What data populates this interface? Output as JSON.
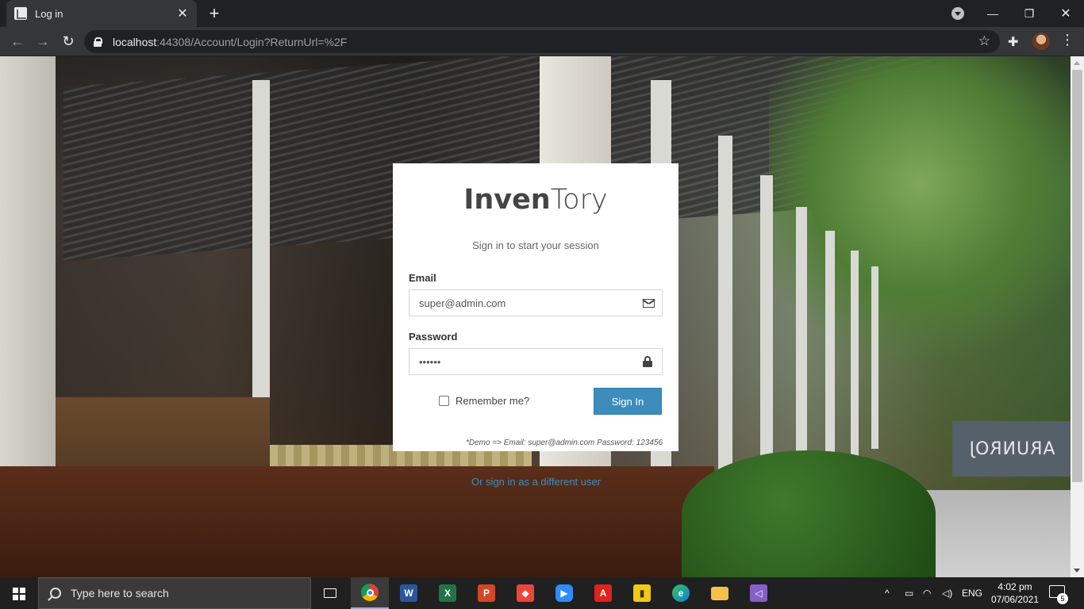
{
  "browser": {
    "tab_title": "Log in",
    "url_host": "localhost",
    "url_path": ":44308/Account/Login?ReturnUrl=%2F"
  },
  "login": {
    "logo_bold": "Inven",
    "logo_light": "Tory",
    "message": "Sign in to start your session",
    "email_label": "Email",
    "email_value": "super@admin.com",
    "password_label": "Password",
    "password_value": "••••••",
    "remember_label": "Remember me?",
    "signin_label": "Sign In",
    "demo_note": "*Demo => Email: super@admin.com Password: 123456"
  },
  "other_signin_link": "Or sign in as a different user",
  "background_sign": "ARUNROJ",
  "taskbar": {
    "search_placeholder": "Type here to search",
    "language": "ENG",
    "time": "4:02 pm",
    "date": "07/06/2021",
    "notification_count": "5",
    "apps": [
      {
        "name": "File Explorer view",
        "icon": "task-view-icon"
      },
      {
        "name": "Chrome",
        "icon": "chrome-icon",
        "color": "#e8453c"
      },
      {
        "name": "Word",
        "icon": "word-icon",
        "color": "#2b579a",
        "glyph": "W"
      },
      {
        "name": "Excel",
        "icon": "excel-icon",
        "color": "#217346",
        "glyph": "X"
      },
      {
        "name": "PowerPoint",
        "icon": "powerpoint-icon",
        "color": "#d24726",
        "glyph": "P"
      },
      {
        "name": "AnyDesk",
        "icon": "anydesk-icon",
        "color": "#ef443b",
        "glyph": "◆"
      },
      {
        "name": "Zoom",
        "icon": "zoom-icon",
        "color": "#2d8cff",
        "glyph": "▶"
      },
      {
        "name": "Acrobat",
        "icon": "acrobat-icon",
        "color": "#e2231a",
        "glyph": "A"
      },
      {
        "name": "Power BI",
        "icon": "powerbi-icon",
        "color": "#f2c811",
        "glyph": "▮"
      },
      {
        "name": "Edge",
        "icon": "edge-icon",
        "color": "#0f7fd6",
        "glyph": "e"
      },
      {
        "name": "Folder",
        "icon": "folder-icon",
        "color": "#f5c04a",
        "glyph": "▬"
      },
      {
        "name": "Visual Studio",
        "icon": "visual-studio-icon",
        "color": "#8661c5",
        "glyph": "◁"
      }
    ]
  },
  "colors": {
    "accent": "#3c8dbc",
    "browser_dark": "#202124",
    "taskbar": "#202020"
  }
}
